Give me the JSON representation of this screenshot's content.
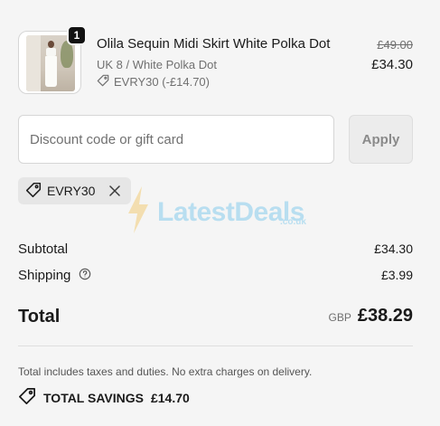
{
  "product": {
    "quantity_badge": "1",
    "name": "Olila Sequin Midi Skirt White Polka Dot",
    "variant": "UK 8 / White Polka Dot",
    "applied_discount": "EVRY30 (-£14.70)",
    "original_price": "£49.00",
    "price": "£34.30"
  },
  "discount": {
    "placeholder": "Discount code or gift card",
    "value": "",
    "apply_label": "Apply",
    "applied_code": "EVRY30"
  },
  "watermark": {
    "text": "LatestDeals",
    "sub": ".co.uk"
  },
  "summary": {
    "subtotal_label": "Subtotal",
    "subtotal_value": "£34.30",
    "shipping_label": "Shipping",
    "shipping_value": "£3.99",
    "total_label": "Total",
    "currency": "GBP",
    "total_value": "£38.29",
    "taxes_note": "Total includes taxes and duties. No extra charges on delivery.",
    "savings_label": "TOTAL SAVINGS",
    "savings_value": "£14.70"
  },
  "icons": {
    "tag": "tag-icon",
    "close": "close-icon",
    "info": "info-icon",
    "bolt": "lightning-icon"
  },
  "colors": {
    "background": "#f5f5f5",
    "text": "#1a1a1a",
    "muted": "#707070",
    "watermark": "#4ab4e8"
  }
}
